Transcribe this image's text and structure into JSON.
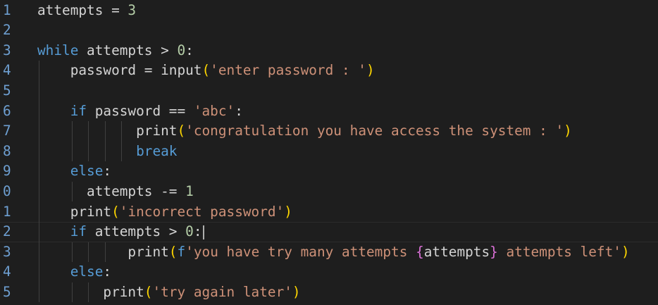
{
  "editor": {
    "language": "python",
    "colors": {
      "background": "#1e1e1e",
      "line_number": "#6e9fd1",
      "keyword_blue": "#569cd6",
      "keyword_purple": "#c586c0",
      "string": "#ce9178",
      "number": "#b5cea8",
      "bracket": "#ffd700"
    },
    "lines": [
      {
        "number": "1",
        "tokens": [
          {
            "t": "attempts = ",
            "c": "plain"
          },
          {
            "t": "3",
            "c": "num"
          }
        ]
      },
      {
        "number": "2",
        "tokens": []
      },
      {
        "number": "3",
        "tokens": [
          {
            "t": "while",
            "c": "kw-blue"
          },
          {
            "t": " attempts > ",
            "c": "plain"
          },
          {
            "t": "0",
            "c": "num"
          },
          {
            "t": ":",
            "c": "plain"
          }
        ]
      },
      {
        "number": "4",
        "tokens": [
          {
            "t": "    password = input",
            "c": "plain"
          },
          {
            "t": "(",
            "c": "paren"
          },
          {
            "t": "'enter password : '",
            "c": "str"
          },
          {
            "t": ")",
            "c": "paren"
          }
        ]
      },
      {
        "number": "5",
        "tokens": []
      },
      {
        "number": "6",
        "tokens": [
          {
            "t": "    ",
            "c": "plain"
          },
          {
            "t": "if",
            "c": "kw-blue"
          },
          {
            "t": " password == ",
            "c": "plain"
          },
          {
            "t": "'abc'",
            "c": "str"
          },
          {
            "t": ":",
            "c": "plain"
          }
        ]
      },
      {
        "number": "7",
        "tokens": [
          {
            "t": "            print",
            "c": "plain"
          },
          {
            "t": "(",
            "c": "paren"
          },
          {
            "t": "'congratulation you have access the system : '",
            "c": "str"
          },
          {
            "t": ")",
            "c": "paren"
          }
        ]
      },
      {
        "number": "8",
        "tokens": [
          {
            "t": "            ",
            "c": "plain"
          },
          {
            "t": "break",
            "c": "kw-blue"
          }
        ]
      },
      {
        "number": "9",
        "tokens": [
          {
            "t": "    ",
            "c": "plain"
          },
          {
            "t": "else",
            "c": "kw-blue"
          },
          {
            "t": ":",
            "c": "plain"
          }
        ]
      },
      {
        "number": "0",
        "tokens": [
          {
            "t": "      attempts -= ",
            "c": "plain"
          },
          {
            "t": "1",
            "c": "num"
          }
        ]
      },
      {
        "number": "1",
        "tokens": [
          {
            "t": "    print",
            "c": "plain"
          },
          {
            "t": "(",
            "c": "paren"
          },
          {
            "t": "'incorrect password'",
            "c": "str"
          },
          {
            "t": ")",
            "c": "paren"
          }
        ]
      },
      {
        "number": "2",
        "tokens": [
          {
            "t": "    ",
            "c": "plain"
          },
          {
            "t": "if",
            "c": "kw-blue"
          },
          {
            "t": " attempts > ",
            "c": "plain"
          },
          {
            "t": "0",
            "c": "num"
          },
          {
            "t": ":",
            "c": "plain"
          }
        ],
        "current": true
      },
      {
        "number": "3",
        "tokens": [
          {
            "t": "           print",
            "c": "plain"
          },
          {
            "t": "(",
            "c": "paren"
          },
          {
            "t": "f",
            "c": "kw-blue"
          },
          {
            "t": "'you have try many attempts ",
            "c": "str"
          },
          {
            "t": "{",
            "c": "brace"
          },
          {
            "t": "attempts",
            "c": "plain"
          },
          {
            "t": "}",
            "c": "brace"
          },
          {
            "t": " attempts left'",
            "c": "str"
          },
          {
            "t": ")",
            "c": "paren"
          }
        ]
      },
      {
        "number": "4",
        "tokens": [
          {
            "t": "    ",
            "c": "plain"
          },
          {
            "t": "else",
            "c": "kw-blue"
          },
          {
            "t": ":",
            "c": "plain"
          }
        ]
      },
      {
        "number": "5",
        "tokens": [
          {
            "t": "        print",
            "c": "plain"
          },
          {
            "t": "(",
            "c": "paren"
          },
          {
            "t": "'try again later'",
            "c": "str"
          },
          {
            "t": ")",
            "c": "paren"
          }
        ]
      }
    ]
  }
}
